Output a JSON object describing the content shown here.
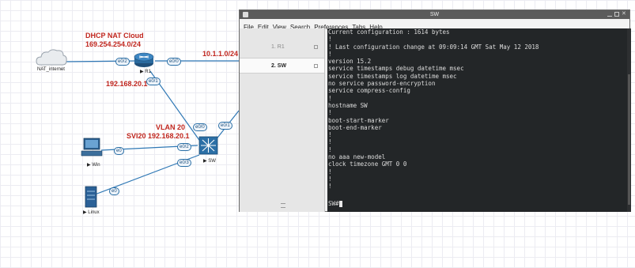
{
  "topology": {
    "cloud_title": "DHCP NAT Cloud",
    "cloud_subnet": "169.254.254.0/24",
    "cloud_name": "NAT_internet",
    "router_name": "R1",
    "r1_e02_subnet": "10.1.1.0/24",
    "r1_e01_ip": "192.168.20.1",
    "vlan_label": "VLAN 20",
    "svi_label": "SVI20 192.168.20.1",
    "switch_name": "SW",
    "win_name": "Win",
    "linux_name": "Linux",
    "ports": {
      "r1_cloud": "e0/2",
      "r1_right": "e0/0",
      "r1_down": "e0/1",
      "sw_up": "e0/0",
      "sw_right": "e0/1",
      "sw_win": "e0/2",
      "sw_linux": "e0/3",
      "win": "e0",
      "linux": "e0"
    }
  },
  "terminal": {
    "title": "SW",
    "menu": [
      "File",
      "Edit",
      "View",
      "Search",
      "Preferences",
      "Tabs",
      "Help"
    ],
    "tabs": [
      {
        "label": "1. R1",
        "active": false
      },
      {
        "label": "2. SW",
        "active": true
      }
    ],
    "lines": [
      "Current configuration : 1614 bytes",
      "!",
      "! Last configuration change at 09:09:14 GMT Sat May 12 2018",
      "!",
      "version 15.2",
      "service timestamps debug datetime msec",
      "service timestamps log datetime msec",
      "no service password-encryption",
      "service compress-config",
      "!",
      "hostname SW",
      "!",
      "boot-start-marker",
      "boot-end-marker",
      "!",
      "!",
      "!",
      "no aaa new-model",
      "clock timezone GMT 0 0",
      "!",
      "!",
      "!"
    ],
    "prompt": "SW#"
  },
  "colors": {
    "label_red": "#c0261e",
    "link_blue": "#2f78b5",
    "terminal_bg": "#232628",
    "titlebar": "#5b5b5b"
  }
}
